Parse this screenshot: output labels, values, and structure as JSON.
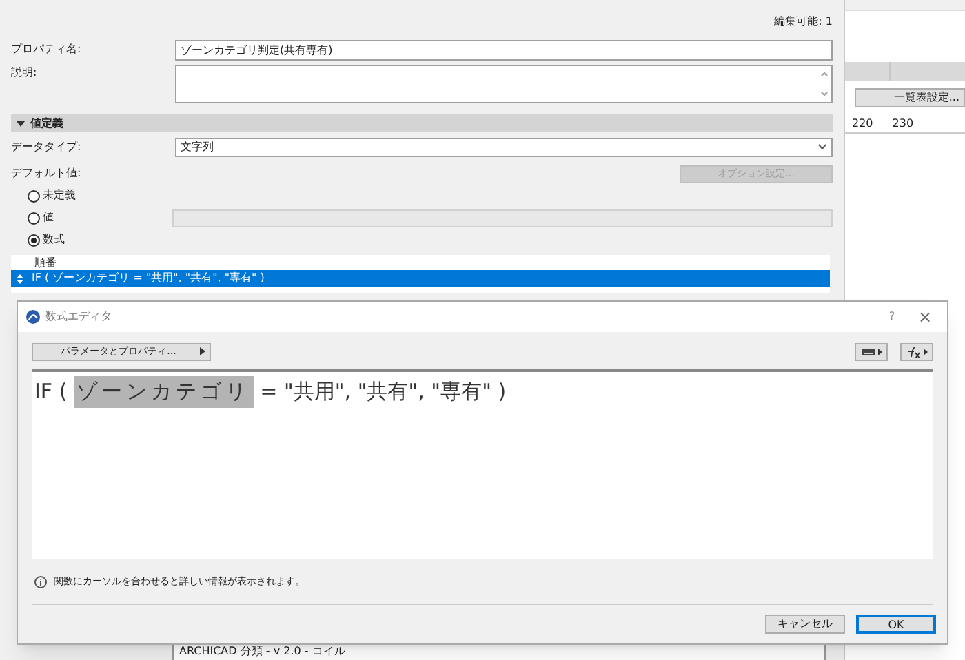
{
  "editable_count": "編集可能: 1",
  "fields": {
    "property_name": {
      "label": "プロパティ名:",
      "value": "ゾーンカテゴリ判定(共有専有)"
    },
    "description": {
      "label": "説明:"
    }
  },
  "section": {
    "title": "値定義",
    "expanded": true
  },
  "data_type": {
    "label": "データタイプ:",
    "value": "文字列"
  },
  "default_value": {
    "label": "デフォルト値:",
    "option_button": {
      "label": "オプション設定...",
      "disabled": true
    },
    "options": [
      {
        "label": "未定義",
        "selected": false
      },
      {
        "label": "値",
        "selected": false
      },
      {
        "label": "数式",
        "selected": true
      }
    ]
  },
  "list": {
    "header": "順番",
    "rows": [
      {
        "text": "IF ( ゾーンカテゴリ = \"共用\", \"共有\", \"専有\" )",
        "selected": true
      }
    ]
  },
  "background": {
    "list_button": "一覧表設定...",
    "ruler": [
      "220",
      "230"
    ],
    "bottom_text": "ARCHICAD 分類 - v 2.0 - コイル"
  },
  "dialog": {
    "title": "数式エディタ",
    "help": "?",
    "close": "×",
    "params_button": "パラメータとプロパティ...",
    "formula": [
      {
        "text": "IF (",
        "highlighted": false
      },
      {
        "text": "ゾーンカテゴリ",
        "highlighted": true
      },
      {
        "text": "= \"共用\", \"共有\", \"専有\" )",
        "highlighted": false
      }
    ],
    "info": "関数にカーソルを合わせると詳しい情報が表示されます。",
    "buttons": [
      {
        "label": "キャンセル",
        "selected": false
      },
      {
        "label": "OK",
        "selected": true
      }
    ]
  }
}
